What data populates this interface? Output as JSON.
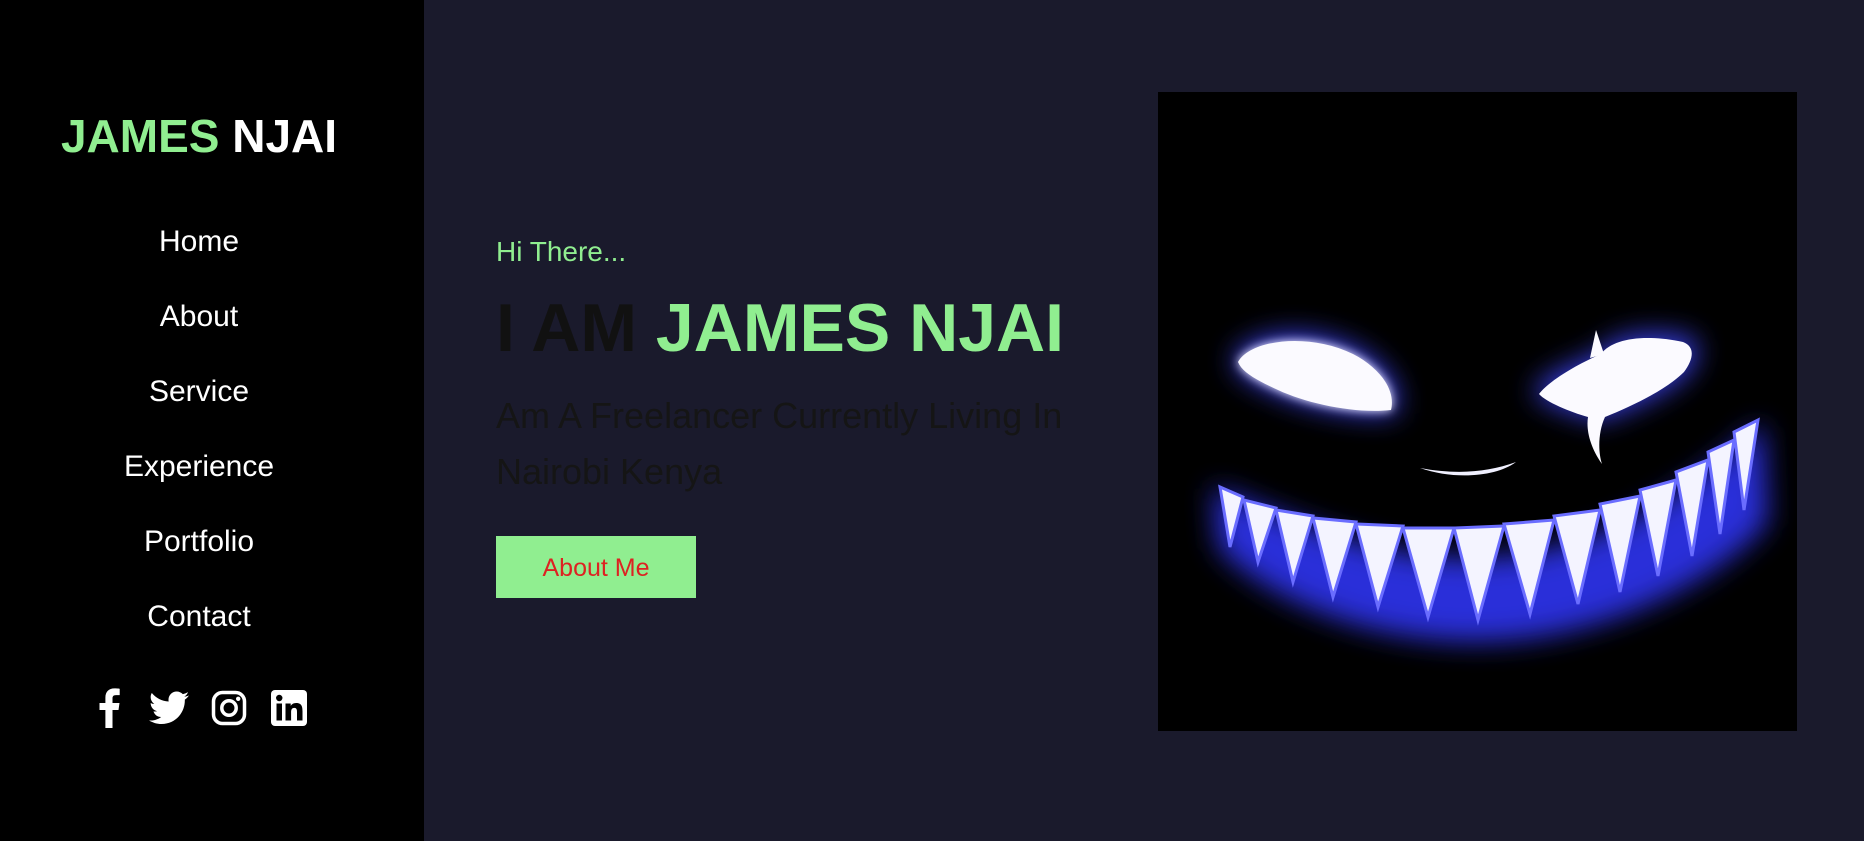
{
  "brand": {
    "first": "JAMES",
    "last": "NJAI"
  },
  "nav": {
    "items": [
      {
        "label": "Home"
      },
      {
        "label": "About"
      },
      {
        "label": "Service"
      },
      {
        "label": "Experience"
      },
      {
        "label": "Portfolio"
      },
      {
        "label": "Contact"
      }
    ]
  },
  "social": [
    "facebook-icon",
    "twitter-icon",
    "instagram-icon",
    "linkedin-icon"
  ],
  "hero": {
    "greeting": "Hi There...",
    "prefix": "I AM",
    "name": "JAMES NJAI",
    "subtitle": "Am A Freelancer Currently Living In Nairobi Kenya",
    "cta_label": "About Me"
  },
  "colors": {
    "accent": "#90ee90",
    "sidebar_bg": "#000000",
    "main_bg": "#1a1a2c",
    "cta_text": "#dd2222"
  }
}
